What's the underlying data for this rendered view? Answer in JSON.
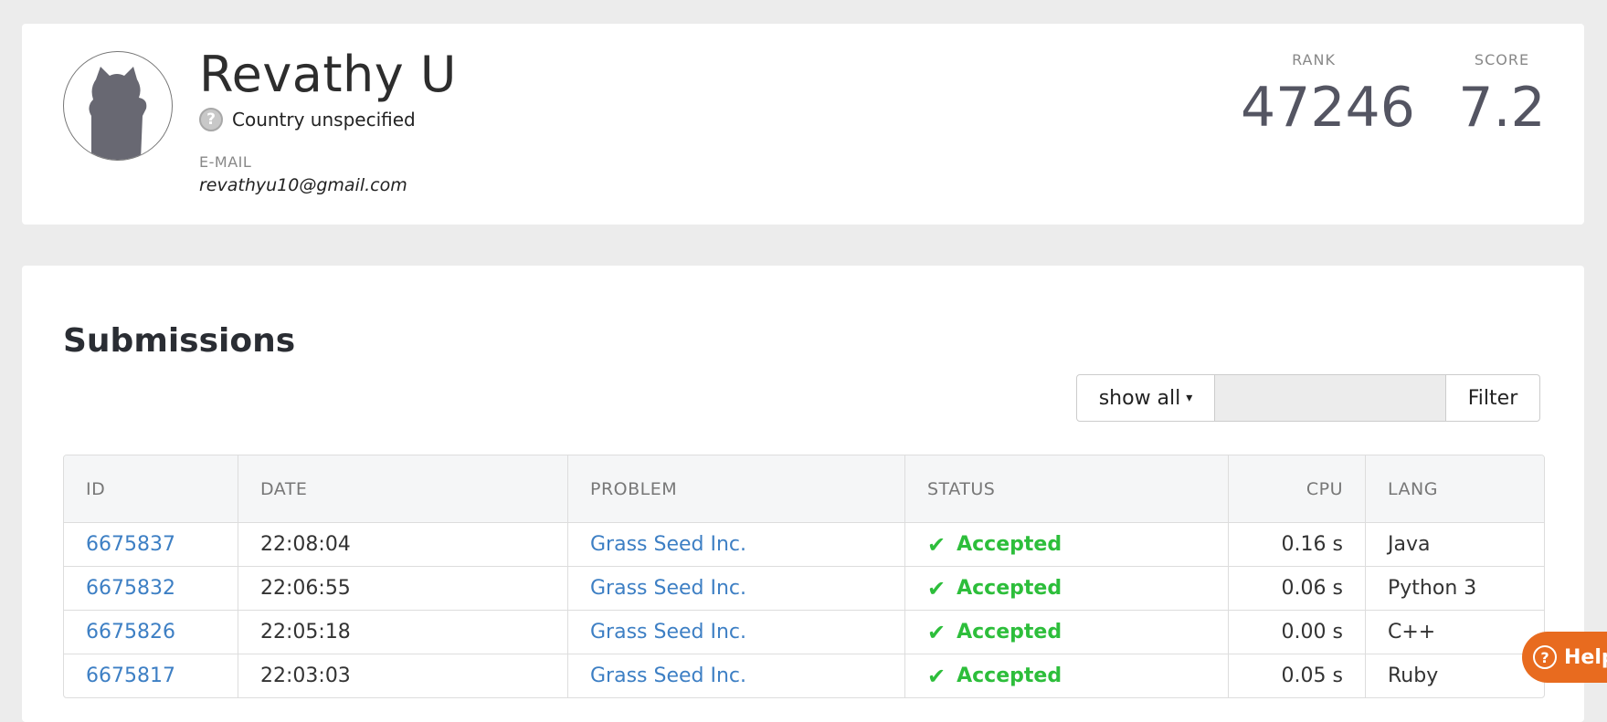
{
  "profile": {
    "name": "Revathy U",
    "country": "Country unspecified",
    "email_label": "E-MAIL",
    "email": "revathyu10@gmail.com",
    "rank_label": "RANK",
    "rank": "47246",
    "score_label": "SCORE",
    "score": "7.2"
  },
  "submissions": {
    "title": "Submissions",
    "filter": {
      "select_value": "show all",
      "input_value": "",
      "button_label": "Filter"
    },
    "columns": [
      "ID",
      "DATE",
      "PROBLEM",
      "STATUS",
      "CPU",
      "LANG"
    ],
    "rows": [
      {
        "id": "6675837",
        "date": "22:08:04",
        "problem": "Grass Seed Inc.",
        "status": "Accepted",
        "cpu": "0.16 s",
        "lang": "Java"
      },
      {
        "id": "6675832",
        "date": "22:06:55",
        "problem": "Grass Seed Inc.",
        "status": "Accepted",
        "cpu": "0.06 s",
        "lang": "Python 3"
      },
      {
        "id": "6675826",
        "date": "22:05:18",
        "problem": "Grass Seed Inc.",
        "status": "Accepted",
        "cpu": "0.00 s",
        "lang": "C++"
      },
      {
        "id": "6675817",
        "date": "22:03:03",
        "problem": "Grass Seed Inc.",
        "status": "Accepted",
        "cpu": "0.05 s",
        "lang": "Ruby"
      }
    ]
  },
  "help": {
    "label": "Help"
  },
  "colors": {
    "accent": "#3d7fc4",
    "accepted": "#2dbe3b",
    "help": "#e86b1f"
  }
}
